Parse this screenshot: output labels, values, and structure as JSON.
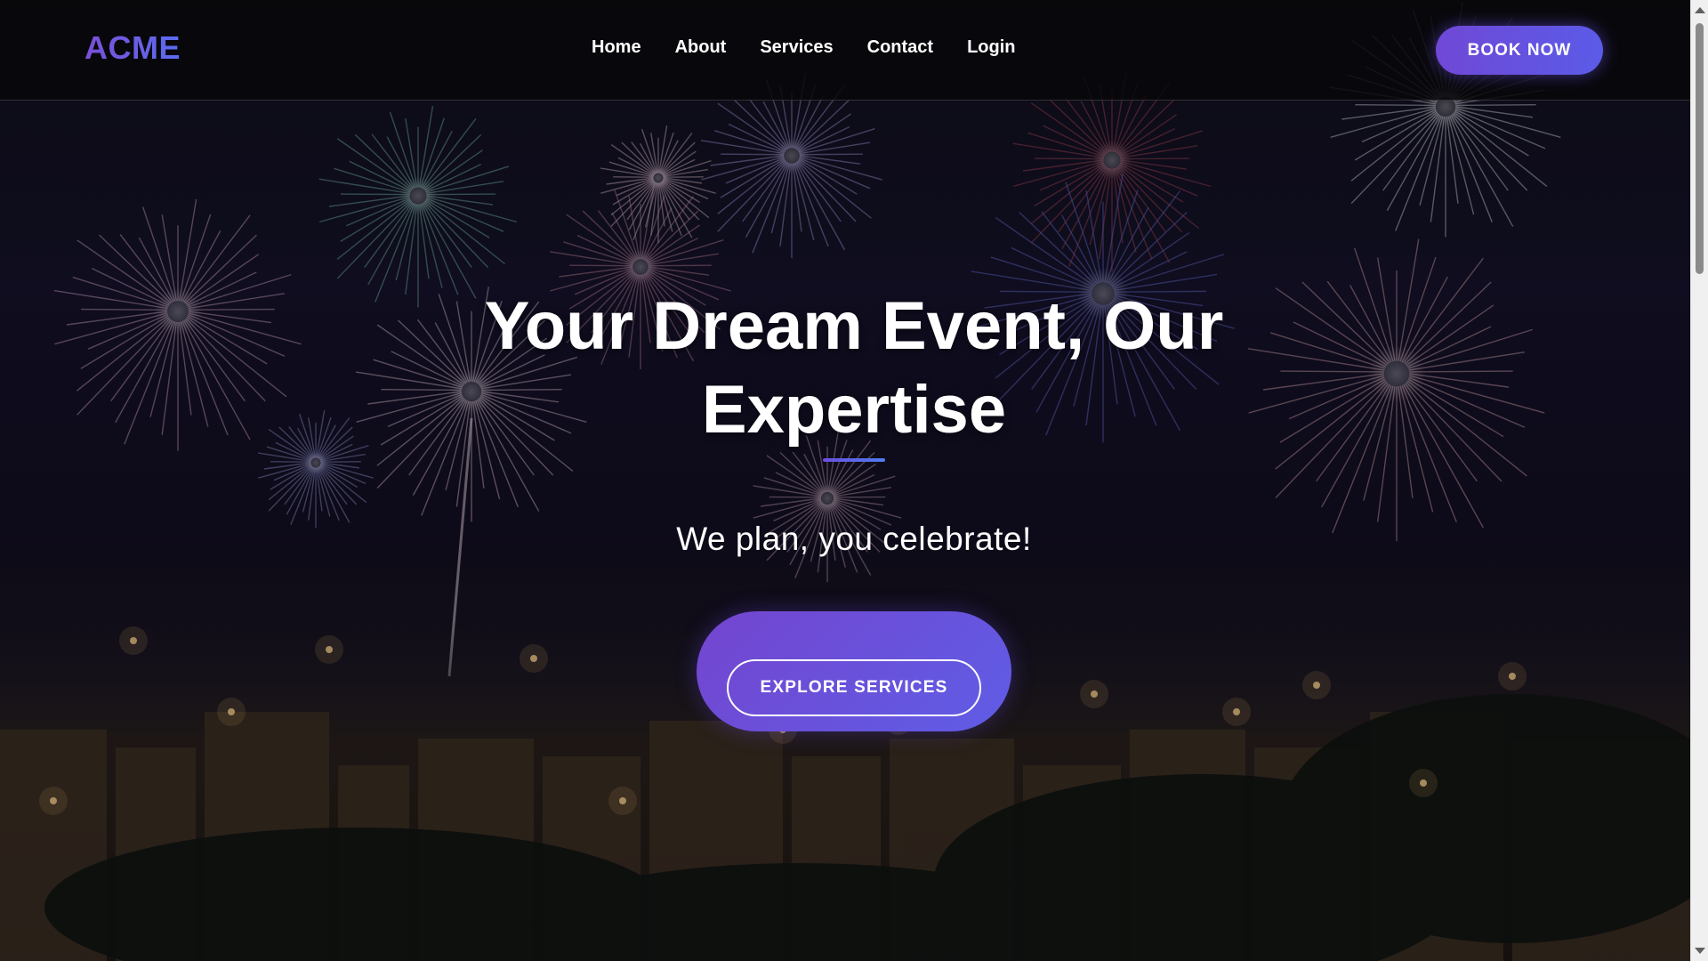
{
  "header": {
    "logo": "ACME",
    "nav": [
      "Home",
      "About",
      "Services",
      "Contact",
      "Login"
    ],
    "cta": "BOOK NOW"
  },
  "hero": {
    "title": "Your Dream Event, Our Expertise",
    "subtitle": "We plan, you celebrate!",
    "cta": "EXPLORE SERVICES"
  },
  "colors": {
    "accent_start": "#7048d6",
    "accent_end": "#5b5be8",
    "header_bg": "#08080a"
  },
  "icons": [
    "fireworks-background",
    "scroll-up-arrow-icon",
    "scroll-down-arrow-icon"
  ]
}
